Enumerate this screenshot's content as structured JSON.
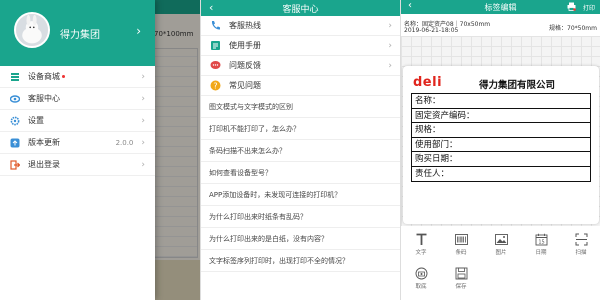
{
  "screen1": {
    "username": "得力集团",
    "bg_size_text": "70*100mm",
    "menu": [
      {
        "label": "设备商城",
        "icon": "store-icon",
        "badge": true
      },
      {
        "label": "客服中心",
        "icon": "headset-icon"
      },
      {
        "label": "设置",
        "icon": "gear-icon"
      },
      {
        "label": "版本更新",
        "icon": "update-icon",
        "value": "2.0.0"
      },
      {
        "label": "退出登录",
        "icon": "logout-icon"
      }
    ],
    "chevron": "›"
  },
  "screen2": {
    "title": "客服中心",
    "back": "‹",
    "rows": [
      {
        "label": "客服热线",
        "icon": "phone-icon"
      },
      {
        "label": "使用手册",
        "icon": "manual-icon"
      },
      {
        "label": "问题反馈",
        "icon": "feedback-icon"
      }
    ],
    "faq_title": "常见问题",
    "faqs": [
      "图文模式与文字模式的区别",
      "打印机不能打印了，怎么办？",
      "条码扫描不出来怎么办？",
      "如何查看设备型号？",
      "APP添加设备时，未发现可连接的打印机？",
      "为什么打印出来时纸条有乱码？",
      "为什么打印出来的是白纸，没有内容？",
      "文字标签序列打印时，出现打印不全的情况？"
    ]
  },
  "screen3": {
    "title": "标签编辑",
    "back": "‹",
    "print_label": "打印",
    "info_name": "名称：固定资产08｜70x50mm",
    "info_date": "2019-06-21-18:05",
    "info_spec": "规格：70*50mm",
    "logo_text": "deli",
    "company": "得力集团有限公司",
    "fields": [
      "名称：",
      "固定资产编码：",
      "规格：",
      "使用部门：",
      "购买日期：",
      "责任人："
    ],
    "tools": [
      {
        "label": "文字",
        "icon": "text-icon"
      },
      {
        "label": "条码",
        "icon": "barcode-icon"
      },
      {
        "label": "图片",
        "icon": "image-icon"
      },
      {
        "label": "日期",
        "icon": "calendar-icon"
      },
      {
        "label": "扫描",
        "icon": "scan-icon"
      },
      {
        "label": "取底",
        "icon": "camera-icon"
      },
      {
        "label": "保存",
        "icon": "save-icon"
      }
    ]
  },
  "colors": {
    "accent": "#1aa58d",
    "logo": "#e0251d"
  }
}
